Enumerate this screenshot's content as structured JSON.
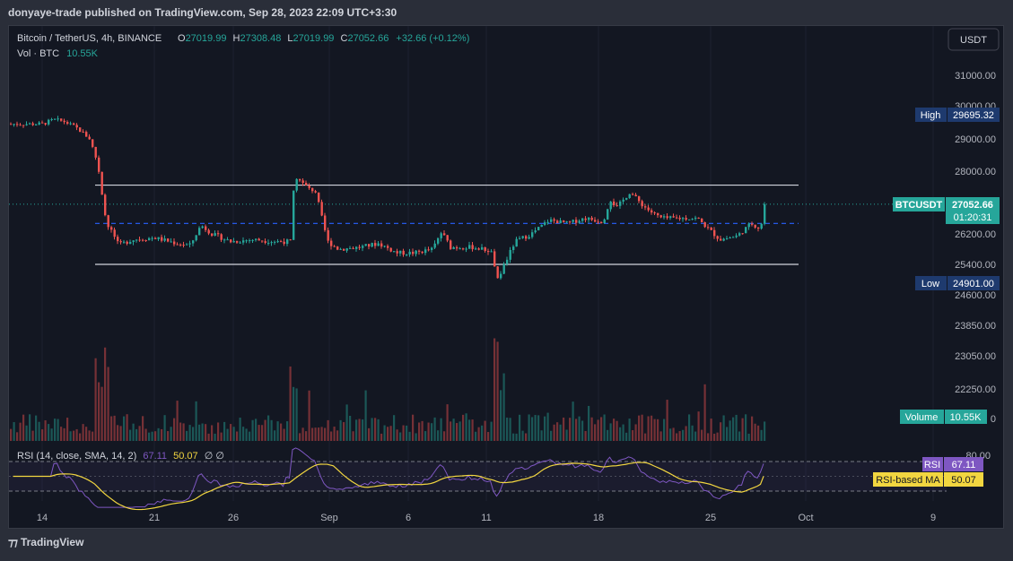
{
  "publisher": "donyaye-trade published on TradingView.com, Sep 28, 2023 22:09 UTC+3:30",
  "footer": {
    "logo_text": "TradingView"
  },
  "header": {
    "symbol": "Bitcoin / TetherUS, 4h, BINANCE",
    "ohlc": [
      {
        "k": "O",
        "v": "27019.99"
      },
      {
        "k": "H",
        "v": "27308.48"
      },
      {
        "k": "L",
        "v": "27019.99"
      },
      {
        "k": "C",
        "v": "27052.66"
      }
    ],
    "change": "+32.66 (+0.12%)",
    "vol_label": "Vol · BTC",
    "vol_value": "10.55K"
  },
  "currency_button": "USDT",
  "colors": {
    "up": "#26a69a",
    "down": "#ef5350",
    "background": "#131722",
    "frame": "#2a2e39",
    "text": "#d1d4dc",
    "axis_text": "#b2b5be",
    "rsi_line": "#7e57c2",
    "rsi_ma": "#f2d640",
    "box_lines": "#d1d4dc",
    "mid_line": "#2962ff",
    "label_navy": "#1e3a6e"
  },
  "labels": {
    "high": {
      "name": "High",
      "value": "29695.32"
    },
    "low": {
      "name": "Low",
      "value": "24901.00"
    },
    "last": {
      "name": "BTCUSDT",
      "value": "27052.66",
      "countdown": "01:20:31"
    },
    "volume": {
      "name": "Volume",
      "value": "10.55K"
    },
    "rsi": {
      "name": "RSI",
      "value": "67.11"
    },
    "rsi_ma": {
      "name": "RSI-based MA",
      "value": "50.07"
    }
  },
  "rsi_header": {
    "title": "RSI (14, close, SMA, 14, 2)",
    "value": "67.11",
    "ma_value": "50.07",
    "extra": "∅ ∅"
  },
  "chart_data": {
    "type": "candlestick",
    "title": "Bitcoin / TetherUS, 4h, BINANCE",
    "x_tick_labels": [
      "14",
      "21",
      "26",
      "Sep",
      "6",
      "11",
      "18",
      "25",
      "Oct",
      "9"
    ],
    "y_tick_labels": [
      "31000.00",
      "30000.00",
      "29000.00",
      "28000.00",
      "26200.00",
      "25400.00",
      "24600.00",
      "23850.00",
      "23050.00",
      "22250.00"
    ],
    "rsi_tick_labels": [
      "80.00"
    ],
    "volume_tick_label": "0",
    "ylim": [
      21700,
      31500
    ],
    "price_path": [
      {
        "x": 0,
        "y": 29450
      },
      {
        "x": 35,
        "y": 29450
      },
      {
        "x": 48,
        "y": 29580
      },
      {
        "x": 60,
        "y": 29520
      },
      {
        "x": 75,
        "y": 29300
      },
      {
        "x": 88,
        "y": 29000
      },
      {
        "x": 96,
        "y": 28300
      },
      {
        "x": 103,
        "y": 27000
      },
      {
        "x": 107,
        "y": 26450
      },
      {
        "x": 112,
        "y": 26300
      },
      {
        "x": 120,
        "y": 25900
      },
      {
        "x": 135,
        "y": 26050
      },
      {
        "x": 160,
        "y": 26100
      },
      {
        "x": 185,
        "y": 25950
      },
      {
        "x": 200,
        "y": 25900
      },
      {
        "x": 212,
        "y": 26450
      },
      {
        "x": 224,
        "y": 26200
      },
      {
        "x": 245,
        "y": 26000
      },
      {
        "x": 270,
        "y": 26050
      },
      {
        "x": 295,
        "y": 26000
      },
      {
        "x": 312,
        "y": 26000
      },
      {
        "x": 316,
        "y": 27900
      },
      {
        "x": 327,
        "y": 27600
      },
      {
        "x": 340,
        "y": 27400
      },
      {
        "x": 348,
        "y": 26500
      },
      {
        "x": 353,
        "y": 26000
      },
      {
        "x": 365,
        "y": 25800
      },
      {
        "x": 390,
        "y": 25850
      },
      {
        "x": 410,
        "y": 25950
      },
      {
        "x": 430,
        "y": 25700
      },
      {
        "x": 450,
        "y": 25700
      },
      {
        "x": 470,
        "y": 25800
      },
      {
        "x": 480,
        "y": 26250
      },
      {
        "x": 490,
        "y": 25850
      },
      {
        "x": 515,
        "y": 25850
      },
      {
        "x": 535,
        "y": 25750
      },
      {
        "x": 543,
        "y": 25000
      },
      {
        "x": 552,
        "y": 25500
      },
      {
        "x": 562,
        "y": 26000
      },
      {
        "x": 580,
        "y": 26200
      },
      {
        "x": 600,
        "y": 26600
      },
      {
        "x": 620,
        "y": 26500
      },
      {
        "x": 640,
        "y": 26650
      },
      {
        "x": 660,
        "y": 26550
      },
      {
        "x": 668,
        "y": 27200
      },
      {
        "x": 675,
        "y": 26950
      },
      {
        "x": 690,
        "y": 27400
      },
      {
        "x": 705,
        "y": 27000
      },
      {
        "x": 715,
        "y": 26800
      },
      {
        "x": 725,
        "y": 26650
      },
      {
        "x": 745,
        "y": 26650
      },
      {
        "x": 765,
        "y": 26650
      },
      {
        "x": 775,
        "y": 26400
      },
      {
        "x": 790,
        "y": 26050
      },
      {
        "x": 810,
        "y": 26150
      },
      {
        "x": 825,
        "y": 26500
      },
      {
        "x": 835,
        "y": 26350
      },
      {
        "x": 842,
        "y": 27050
      }
    ],
    "box_levels": {
      "resistance": 27600,
      "mid": 26500,
      "support": 25400
    },
    "rsi": {
      "ylim": [
        0,
        100
      ],
      "upper": 70,
      "lower": 30,
      "last": 67.11,
      "ma_last": 50.07
    }
  }
}
